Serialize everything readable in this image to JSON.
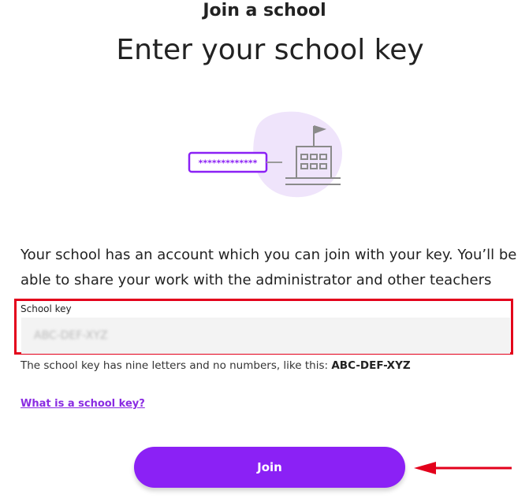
{
  "header": {
    "eyebrow": "Join a school",
    "title": "Enter your school key"
  },
  "illustration": {
    "key_text": "*************",
    "blob_color": "#efe4fb",
    "accent_color": "#8b21f5",
    "school_icon": "school-building-icon"
  },
  "description": "Your school has an account which you can join with your key. You’ll be able to share your work with the administrator and other teachers",
  "school_key_field": {
    "label": "School key",
    "value": "",
    "placeholder": "ABC-DEF-XYZ",
    "hint_prefix": "The school key has nine letters and no numbers, like this:",
    "hint_example": "ABC-DEF-XYZ"
  },
  "help_link": "What is a school key?",
  "join_button": {
    "label": "Join",
    "color": "#8b21f5"
  },
  "annotation": {
    "highlight_color": "#e3001b"
  }
}
